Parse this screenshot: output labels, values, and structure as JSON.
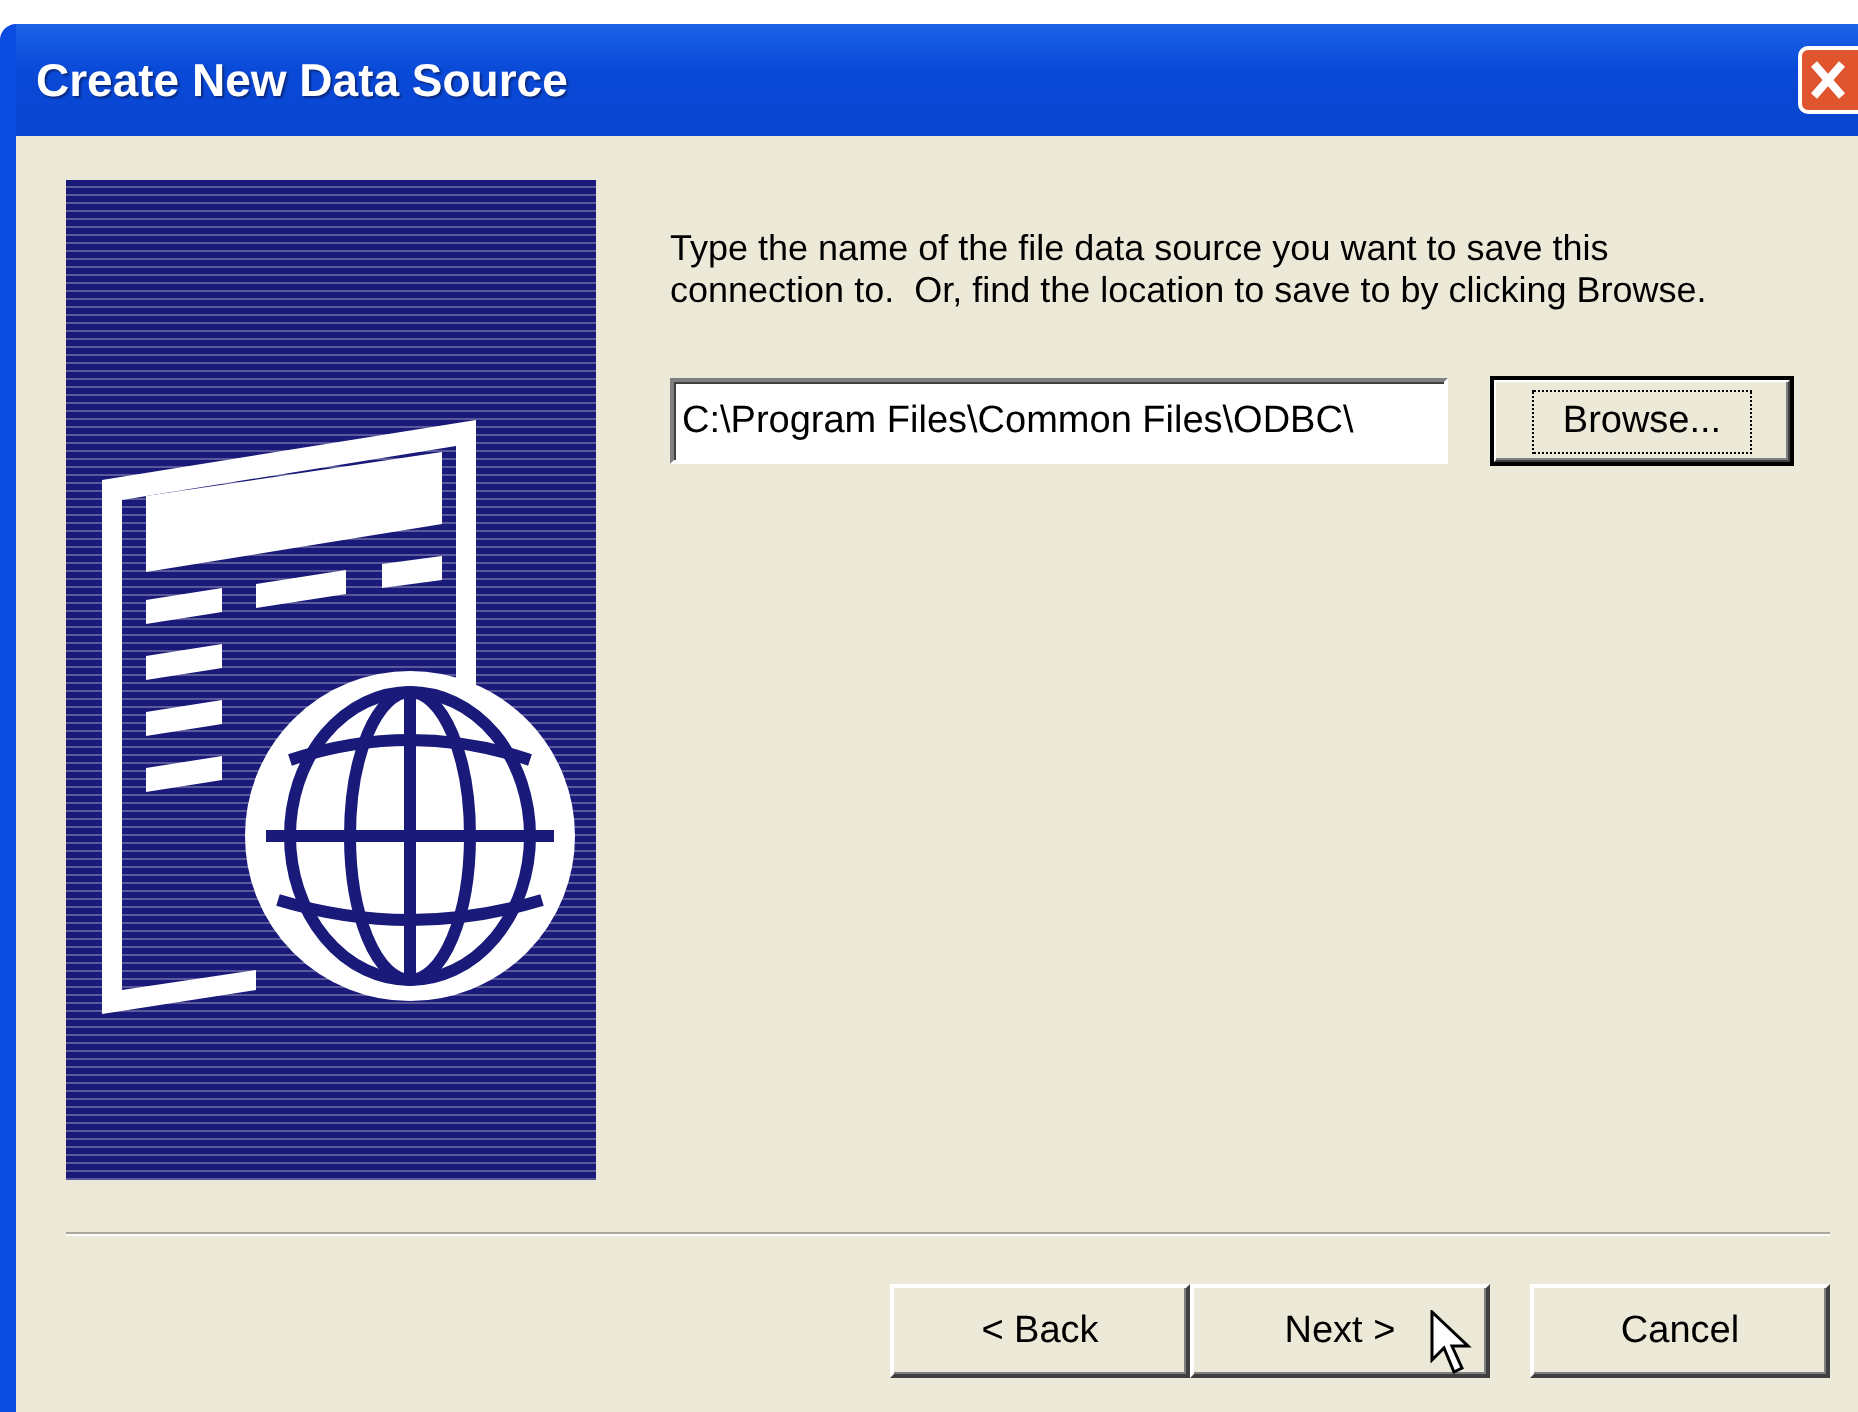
{
  "window": {
    "title": "Create New Data Source"
  },
  "instructions": "Type the name of the file data source you want to save this connection to.  Or, find the location to save to by clicking Browse.",
  "file_field": {
    "value": "C:\\Program Files\\Common Files\\ODBC\\"
  },
  "browse_button": {
    "label": "Browse...",
    "focused": true
  },
  "buttons": [
    {
      "label": "< Back",
      "kind": "back"
    },
    {
      "label": "Next >",
      "kind": "next"
    },
    {
      "label": "Cancel",
      "kind": "cancel"
    }
  ]
}
